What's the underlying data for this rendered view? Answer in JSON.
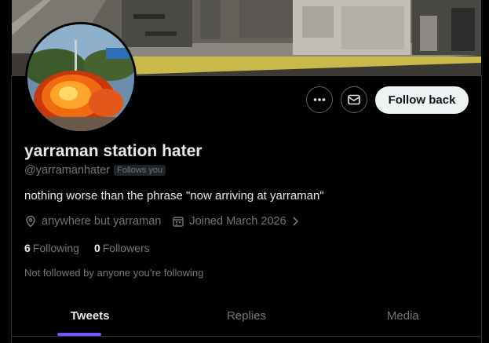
{
  "profile": {
    "display_name": "yarraman station hater",
    "handle": "@yarramanhater",
    "follows_you_badge": "Follows you",
    "bio": "nothing worse than the phrase \"now arriving at yarraman\"",
    "location": "anywhere but yarraman",
    "joined": "Joined March 2026"
  },
  "actions": {
    "more_icon": "more-horizontal-icon",
    "message_icon": "envelope-icon",
    "follow_back_label": "Follow back"
  },
  "stats": {
    "following_count": "6",
    "following_label": "Following",
    "followers_count": "0",
    "followers_label": "Followers"
  },
  "social_context": "Not followed by anyone you’re following",
  "tabs": [
    {
      "label": "Tweets",
      "active": true
    },
    {
      "label": "Replies",
      "active": false
    },
    {
      "label": "Media",
      "active": false
    }
  ],
  "colors": {
    "background": "#000000",
    "text_primary": "#e7e9ea",
    "text_secondary": "#71767b",
    "border": "#2f3336",
    "tab_accent": "#7856ff",
    "follow_button_bg": "#eff3f4"
  }
}
